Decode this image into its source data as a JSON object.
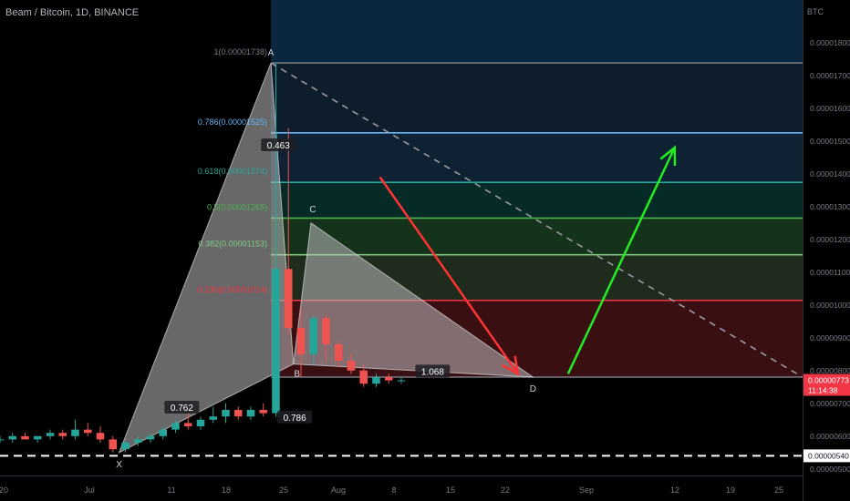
{
  "header": {
    "title": "Beam / Bitcoin, 1D, BINANCE"
  },
  "chart_data": {
    "type": "candlestick",
    "currency": "BTC",
    "ylim": [
      4.8e-06,
      1.93e-05
    ],
    "y_ticks": [
      "0.00000500",
      "0.00000600",
      "0.00000700",
      "0.00000800",
      "0.00000900",
      "0.00001000",
      "0.00001100",
      "0.00001200",
      "0.00001300",
      "0.00001400",
      "0.00001500",
      "0.00001600",
      "0.00001700",
      "0.00001800"
    ],
    "y_tick_values": [
      5e-06,
      6e-06,
      7e-06,
      8e-06,
      9e-06,
      1e-05,
      1.1e-05,
      1.2e-05,
      1.3e-05,
      1.4e-05,
      1.5e-05,
      1.6e-05,
      1.7e-05,
      1.8e-05
    ],
    "x_axis": {
      "start_day": 20,
      "end_day": 84,
      "ticks": [
        {
          "label": "20",
          "day": 20
        },
        {
          "label": "Jul",
          "day": 30
        },
        {
          "label": "11",
          "day": 41
        },
        {
          "label": "18",
          "day": 48
        },
        {
          "label": "25",
          "day": 55
        },
        {
          "label": "Aug",
          "day": 61
        },
        {
          "label": "8",
          "day": 67
        },
        {
          "label": "15",
          "day": 74
        },
        {
          "label": "22",
          "day": 81
        },
        {
          "label": "Sep",
          "day": 93
        },
        {
          "label": "12",
          "day": 104
        },
        {
          "label": "19",
          "day": 111
        },
        {
          "label": "25",
          "day": 117
        }
      ]
    },
    "fib_levels": [
      {
        "ratio": "1",
        "label": "1(0.00001738)",
        "price": 1.738e-05,
        "color": "#787b86"
      },
      {
        "ratio": "0.786",
        "label": "0.786(0.00001525)",
        "price": 1.525e-05,
        "color": "#64b5f6"
      },
      {
        "ratio": "0.618",
        "label": "0.618(0.00001374)",
        "price": 1.374e-05,
        "color": "#26a69a"
      },
      {
        "ratio": "0.5",
        "label": "0.5(0.00001265)",
        "price": 1.265e-05,
        "color": "#4caf50"
      },
      {
        "ratio": "0.382",
        "label": "0.382(0.00001153)",
        "price": 1.153e-05,
        "color": "#81c784"
      },
      {
        "ratio": "0.236",
        "label": "0.236(0.00001014)",
        "price": 1.014e-05,
        "color": "#f23645"
      },
      {
        "ratio": "0",
        "label": "",
        "price": 7.8e-06,
        "color": "#787b86"
      }
    ],
    "candles": [
      [
        20,
        5.9e-06,
        6e-06,
        5.8e-06,
        5.9e-06
      ],
      [
        21,
        5.9e-06,
        6.1e-06,
        5.8e-06,
        6e-06
      ],
      [
        22,
        6e-06,
        6.1e-06,
        5.9e-06,
        5.9e-06
      ],
      [
        23,
        5.9e-06,
        6e-06,
        5.8e-06,
        6e-06
      ],
      [
        24,
        6e-06,
        6.2e-06,
        5.9e-06,
        6.1e-06
      ],
      [
        25,
        6.1e-06,
        6.2e-06,
        5.9e-06,
        6e-06
      ],
      [
        26,
        6e-06,
        6.5e-06,
        5.9e-06,
        6.2e-06
      ],
      [
        27,
        6.2e-06,
        6.4e-06,
        6e-06,
        6.1e-06
      ],
      [
        28,
        6.1e-06,
        6.3e-06,
        5.8e-06,
        5.9e-06
      ],
      [
        29,
        5.9e-06,
        6e-06,
        5.5e-06,
        5.6e-06
      ],
      [
        30,
        5.6e-06,
        5.9e-06,
        5.5e-06,
        5.8e-06
      ],
      [
        31,
        5.8e-06,
        6e-06,
        5.7e-06,
        5.9e-06
      ],
      [
        32,
        5.9e-06,
        6.1e-06,
        5.8e-06,
        6e-06
      ],
      [
        33,
        6e-06,
        6.3e-06,
        5.9e-06,
        6.2e-06
      ],
      [
        34,
        6.2e-06,
        6.5e-06,
        6.1e-06,
        6.4e-06
      ],
      [
        35,
        6.4e-06,
        6.7e-06,
        6.2e-06,
        6.3e-06
      ],
      [
        36,
        6.3e-06,
        6.6e-06,
        6.2e-06,
        6.5e-06
      ],
      [
        37,
        6.5e-06,
        6.9e-06,
        6.4e-06,
        6.6e-06
      ],
      [
        38,
        6.6e-06,
        7e-06,
        6.4e-06,
        6.8e-06
      ],
      [
        39,
        6.8e-06,
        6.9e-06,
        6.5e-06,
        6.6e-06
      ],
      [
        40,
        6.6e-06,
        6.9e-06,
        6.5e-06,
        6.8e-06
      ],
      [
        41,
        6.8e-06,
        7e-06,
        6.6e-06,
        6.7e-06
      ],
      [
        42,
        6.7e-06,
        1.74e-05,
        6.6e-06,
        1.11e-05
      ],
      [
        43,
        1.11e-05,
        1.54e-05,
        9.1e-06,
        9.3e-06
      ],
      [
        44,
        9.3e-06,
        9.9e-06,
        7.8e-06,
        8.5e-06
      ],
      [
        45,
        8.5e-06,
        9.7e-06,
        8.2e-06,
        9.6e-06
      ],
      [
        46,
        9.6e-06,
        9.7e-06,
        8.3e-06,
        8.8e-06
      ],
      [
        47,
        8.8e-06,
        8.9e-06,
        8.1e-06,
        8.3e-06
      ],
      [
        48,
        8.3e-06,
        8.5e-06,
        7.9e-06,
        8e-06
      ],
      [
        49,
        8e-06,
        8.2e-06,
        7.5e-06,
        7.6e-06
      ],
      [
        50,
        7.6e-06,
        7.9e-06,
        7.5e-06,
        7.8e-06
      ],
      [
        51,
        7.8e-06,
        7.9e-06,
        7.6e-06,
        7.7e-06
      ],
      [
        52,
        7.7e-06,
        7.8e-06,
        7.6e-06,
        7.7e-06
      ]
    ],
    "harmonic_points": [
      {
        "name": "X",
        "day": 29.5,
        "price": 5.5e-06
      },
      {
        "name": "A",
        "day": 41.6,
        "price": 1.738e-05
      },
      {
        "name": "B",
        "day": 43.4,
        "price": 8.2e-06
      },
      {
        "name": "C",
        "day": 44.8,
        "price": 1.25e-05
      },
      {
        "name": "D",
        "day": 62.5,
        "price": 7.8e-06
      }
    ],
    "ratios": [
      {
        "label": "0.463",
        "day": 42.2,
        "price": 1.48e-05
      },
      {
        "label": "0.762",
        "day": 34.5,
        "price": 6.8e-06
      },
      {
        "label": "0.786",
        "day": 43.5,
        "price": 6.5e-06
      },
      {
        "label": "1.068",
        "day": 54.5,
        "price": 7.9e-06
      }
    ],
    "support_level": {
      "price": 5.4e-06,
      "label": "0.00000540"
    },
    "current_price": {
      "price": 7.73e-06,
      "label": "0.00000773",
      "countdown": "11:14:38"
    },
    "arrows": [
      {
        "color": "#ff3333",
        "from_day": 50.3,
        "from_price": 1.39e-05,
        "to_day": 61.3,
        "to_price": 7.9e-06
      },
      {
        "color": "#22ee22",
        "from_day": 65.3,
        "from_price": 7.9e-06,
        "to_day": 73.8,
        "to_price": 1.48e-05
      }
    ],
    "trend_line": {
      "from_day": 41.6,
      "from_price": 1.738e-05,
      "to_day": 84,
      "to_price": 7.8e-06
    }
  },
  "colors": {
    "bull": "#26a69a",
    "bear": "#ef5350",
    "axis_text": "#787b86",
    "background": "#000000",
    "price_badge": "#f23645",
    "support_badge": "#ffffff"
  }
}
